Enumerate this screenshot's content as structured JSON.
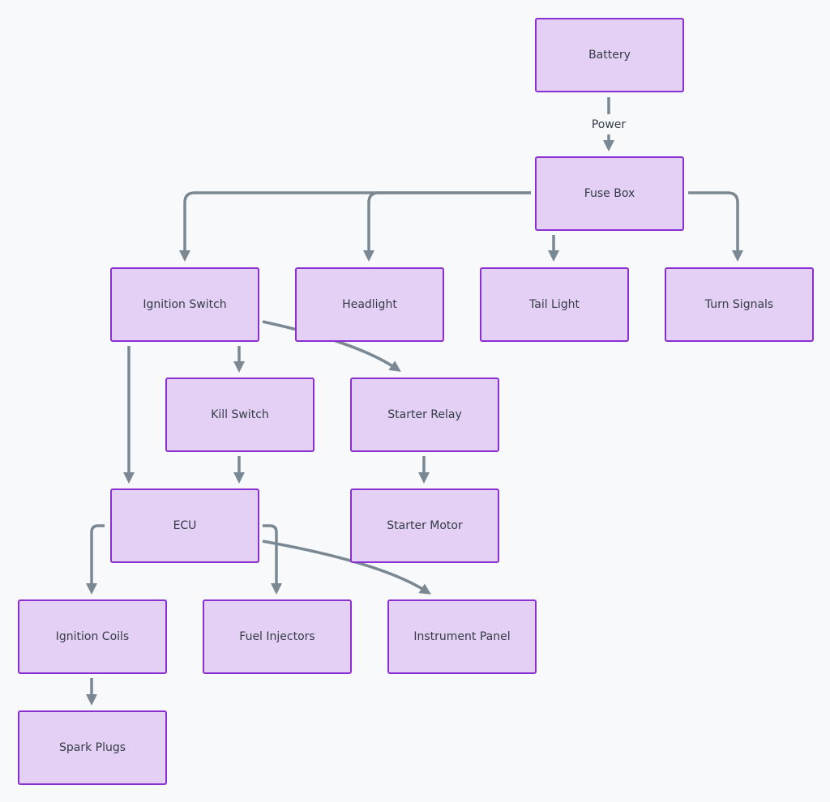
{
  "nodes": {
    "battery": "Battery",
    "fuse_box": "Fuse Box",
    "ignition_switch": "Ignition Switch",
    "headlight": "Headlight",
    "tail_light": "Tail Light",
    "turn_signals": "Turn Signals",
    "kill_switch": "Kill Switch",
    "starter_relay": "Starter Relay",
    "ecu": "ECU",
    "starter_motor": "Starter Motor",
    "ignition_coils": "Ignition Coils",
    "fuel_injectors": "Fuel Injectors",
    "instrument_panel": "Instrument Panel",
    "spark_plugs": "Spark Plugs"
  },
  "edges": [
    {
      "from": "Battery",
      "to": "Fuse Box",
      "label": "Power"
    },
    {
      "from": "Fuse Box",
      "to": "Ignition Switch"
    },
    {
      "from": "Fuse Box",
      "to": "Headlight"
    },
    {
      "from": "Fuse Box",
      "to": "Tail Light"
    },
    {
      "from": "Fuse Box",
      "to": "Turn Signals"
    },
    {
      "from": "Ignition Switch",
      "to": "Kill Switch"
    },
    {
      "from": "Ignition Switch",
      "to": "Starter Relay"
    },
    {
      "from": "Ignition Switch",
      "to": "ECU"
    },
    {
      "from": "Kill Switch",
      "to": "ECU"
    },
    {
      "from": "Starter Relay",
      "to": "Starter Motor"
    },
    {
      "from": "ECU",
      "to": "Ignition Coils"
    },
    {
      "from": "ECU",
      "to": "Fuel Injectors"
    },
    {
      "from": "ECU",
      "to": "Instrument Panel"
    },
    {
      "from": "Ignition Coils",
      "to": "Spark Plugs"
    }
  ],
  "colors": {
    "background": "#f8f9fa",
    "node_fill": "#e4d0f4",
    "node_border": "#8a2fd2",
    "edge": "#7a8894",
    "text": "#333c47"
  }
}
